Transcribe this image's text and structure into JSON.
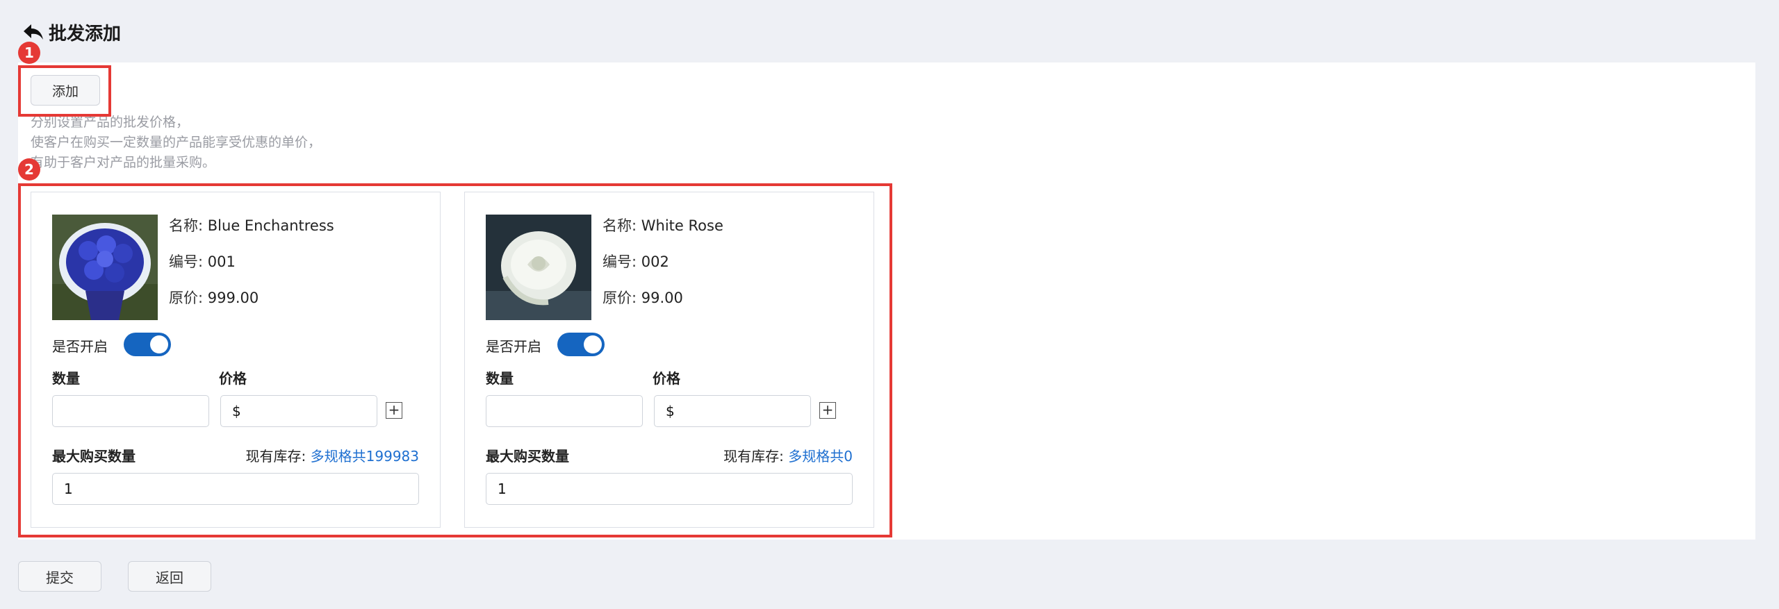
{
  "header": {
    "title": "批发添加",
    "back_icon": "back-arrow-icon"
  },
  "toolbar": {
    "add_label": "添加"
  },
  "markers": [
    "1",
    "2"
  ],
  "hint_lines": [
    "分别设置产品的批发价格，",
    "使客户在购买一定数量的产品能享受优惠的单价，",
    "有助于客户对产品的批量采购。"
  ],
  "labels": {
    "name": "名称:",
    "code": "编号:",
    "original_price": "原价:",
    "enabled": "是否开启",
    "quantity": "数量",
    "price": "价格",
    "max_qty": "最大购买数量",
    "stock": "现有库存:",
    "currency": "$",
    "plus": "+"
  },
  "products": [
    {
      "name": "Blue Enchantress",
      "code": "001",
      "original_price": "999.00",
      "enabled": true,
      "quantity": "",
      "price": "",
      "stock_link": "多规格共199983",
      "max_qty": "1"
    },
    {
      "name": "White Rose",
      "code": "002",
      "original_price": "99.00",
      "enabled": true,
      "quantity": "",
      "price": "",
      "stock_link": "多规格共0",
      "max_qty": "1"
    }
  ],
  "footer": {
    "submit_label": "提交",
    "back_label": "返回"
  },
  "colors": {
    "accent": "#1565c0",
    "link": "#1e6fd0",
    "highlight": "#e53935",
    "background": "#eef0f5"
  }
}
